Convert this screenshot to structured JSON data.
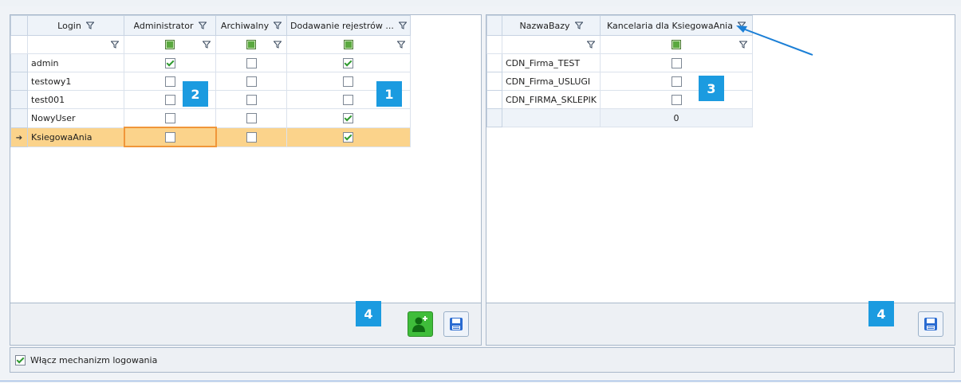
{
  "left_grid": {
    "headers": {
      "login": "Login",
      "administrator": "Administrator",
      "archiwalny": "Archiwalny",
      "dodawanie": "Dodawanie rejestrów ..."
    },
    "rows": [
      {
        "login": "admin",
        "administrator": true,
        "archiwalny": false,
        "dodawanie": true
      },
      {
        "login": "testowy1",
        "administrator": false,
        "archiwalny": false,
        "dodawanie": false
      },
      {
        "login": "test001",
        "administrator": false,
        "archiwalny": false,
        "dodawanie": false
      },
      {
        "login": "NowyUser",
        "administrator": false,
        "archiwalny": false,
        "dodawanie": true
      },
      {
        "login": "KsiegowaAnia",
        "administrator": false,
        "archiwalny": false,
        "dodawanie": true,
        "selected": true
      }
    ]
  },
  "right_grid": {
    "headers": {
      "nazwa_bazy": "NazwaBazy",
      "kancelaria": "Kancelaria dla KsiegowaAnia"
    },
    "rows": [
      {
        "nazwa_bazy": "CDN_Firma_TEST",
        "kancelaria": false
      },
      {
        "nazwa_bazy": "CDN_Firma_USLUGI",
        "kancelaria": false
      },
      {
        "nazwa_bazy": "CDN_FIRMA_SKLEPIK",
        "kancelaria": false
      }
    ],
    "summary": "0"
  },
  "badges": {
    "b1": "1",
    "b2": "2",
    "b3": "3",
    "b4_left": "4",
    "b4_right": "4"
  },
  "footer_option": {
    "label": "Włącz mechanizm logowania",
    "checked": true
  },
  "icons": {
    "filter": "funnel-icon",
    "add_user": "add-user-icon",
    "save": "floppy-disk-icon",
    "row_indicator": "row-arrow-icon"
  },
  "colors": {
    "badge": "#1b9be0",
    "selected_row": "#fbd38b",
    "focus_border": "#f0963a",
    "check": "#2f9a2f",
    "add_user_bg": "#3fbd3a",
    "arrow": "#1b7fd6"
  }
}
